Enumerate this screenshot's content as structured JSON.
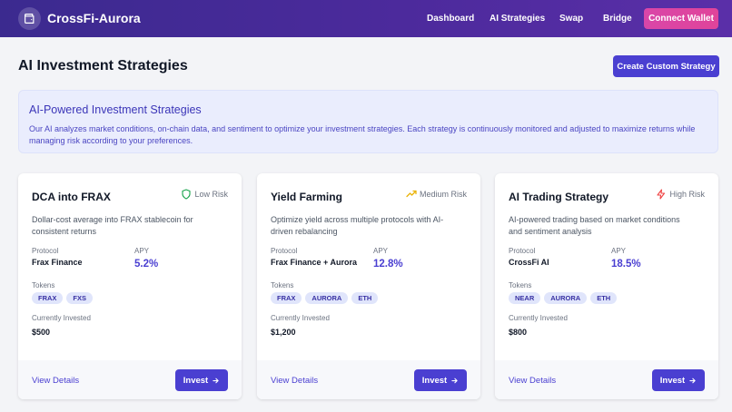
{
  "nav": {
    "brand": "CrossFi-Aurora",
    "links": [
      "Dashboard",
      "AI Strategies",
      "Swap",
      "Bridge"
    ],
    "connect_label": "Connect Wallet"
  },
  "header": {
    "title": "AI Investment Strategies",
    "create_label": "Create Custom Strategy"
  },
  "info": {
    "title": "AI-Powered Investment Strategies",
    "text": "Our AI analyzes market conditions, on-chain data, and sentiment to optimize your investment strategies. Each strategy is continuously monitored and adjusted to maximize returns while managing risk according to your preferences."
  },
  "labels": {
    "protocol": "Protocol",
    "apy": "APY",
    "tokens": "Tokens",
    "invested": "Currently Invested",
    "details": "View Details",
    "invest": "Invest"
  },
  "cards": [
    {
      "title": "DCA into FRAX",
      "risk": "Low Risk",
      "risk_icon": "shield-icon",
      "risk_color": "#16a34a",
      "desc": "Dollar-cost average into FRAX stablecoin for consistent returns",
      "protocol": "Frax Finance",
      "apy": "5.2%",
      "tokens": [
        "FRAX",
        "FXS"
      ],
      "invested": "$500"
    },
    {
      "title": "Yield Farming",
      "risk": "Medium Risk",
      "risk_icon": "trending-up-icon",
      "risk_color": "#eab308",
      "desc": "Optimize yield across multiple protocols with AI-driven rebalancing",
      "protocol": "Frax Finance + Aurora",
      "apy": "12.8%",
      "tokens": [
        "FRAX",
        "AURORA",
        "ETH"
      ],
      "invested": "$1,200"
    },
    {
      "title": "AI Trading Strategy",
      "risk": "High Risk",
      "risk_icon": "lightning-icon",
      "risk_color": "#ef4444",
      "desc": "AI-powered trading based on market conditions and sentiment analysis",
      "protocol": "CrossFi AI",
      "apy": "18.5%",
      "tokens": [
        "NEAR",
        "AURORA",
        "ETH"
      ],
      "invested": "$800"
    }
  ]
}
